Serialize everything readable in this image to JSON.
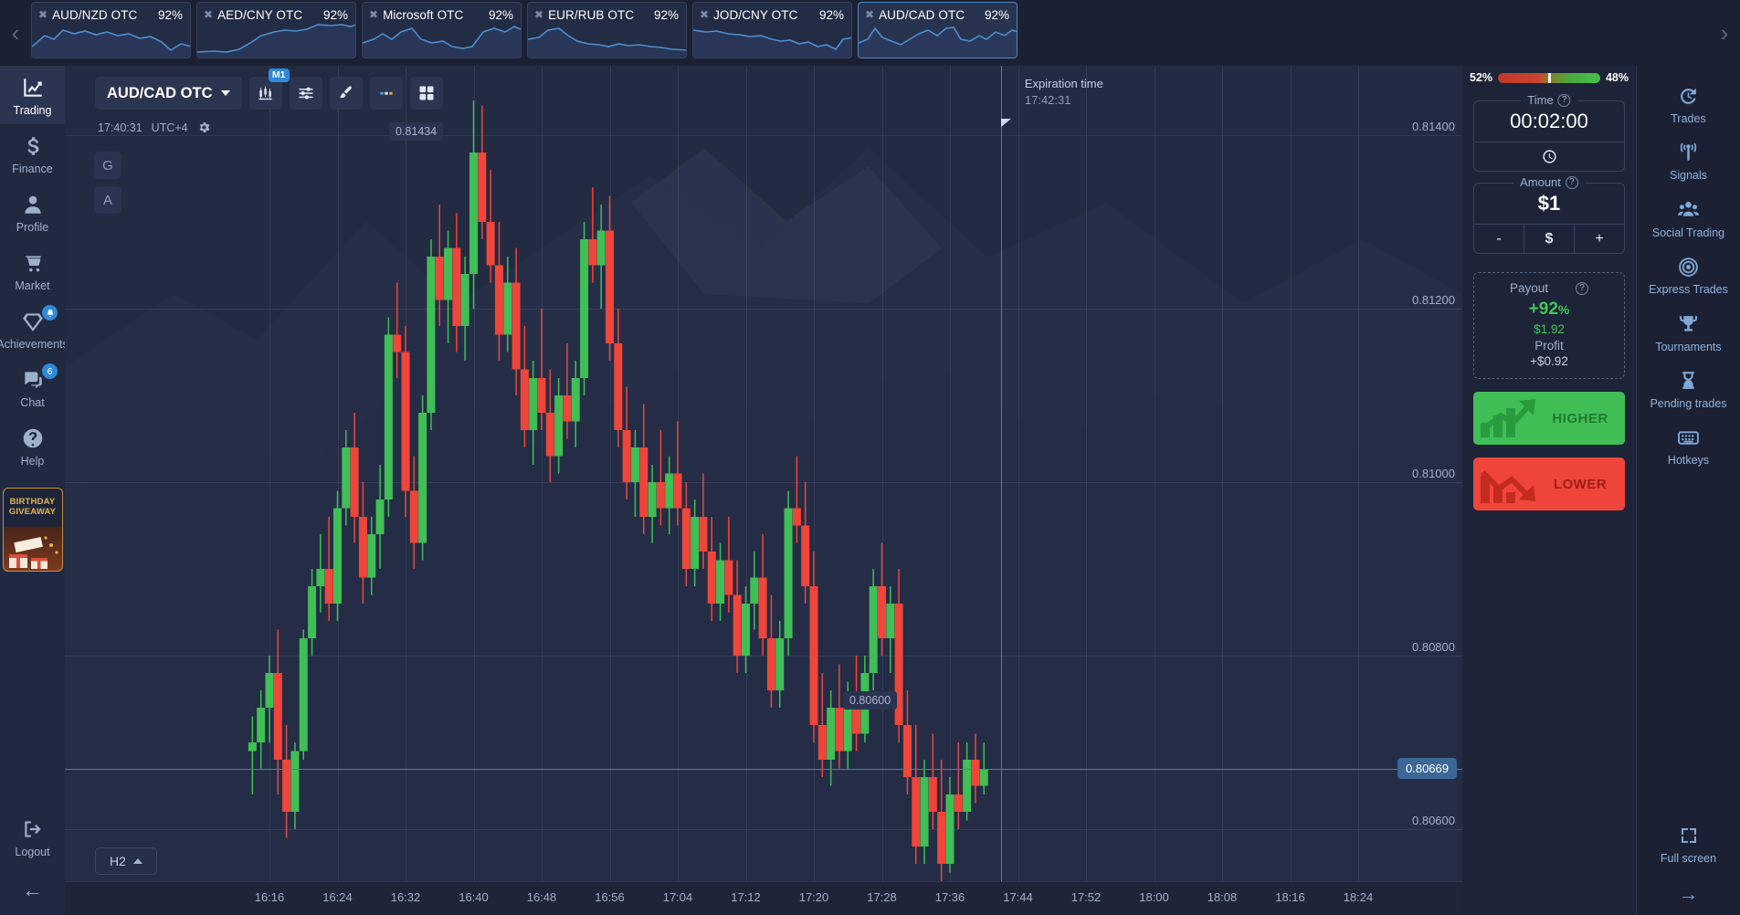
{
  "tabs": {
    "prev_arrow": "‹",
    "next_arrow": "›",
    "close_glyph": "✖",
    "items": [
      {
        "name": "AUD/NZD OTC",
        "percent": "92%",
        "active": false
      },
      {
        "name": "AED/CNY OTC",
        "percent": "92%",
        "active": false
      },
      {
        "name": "Microsoft OTC",
        "percent": "92%",
        "active": false
      },
      {
        "name": "EUR/RUB OTC",
        "percent": "92%",
        "active": false
      },
      {
        "name": "JOD/CNY OTC",
        "percent": "92%",
        "active": false
      },
      {
        "name": "AUD/CAD OTC",
        "percent": "92%",
        "active": true
      }
    ]
  },
  "sidebar_left": {
    "items": [
      {
        "label": "Trading",
        "icon": "chart-line-icon",
        "active": true,
        "badge": ""
      },
      {
        "label": "Finance",
        "icon": "dollar-icon",
        "active": false,
        "badge": ""
      },
      {
        "label": "Profile",
        "icon": "user-icon",
        "active": false,
        "badge": ""
      },
      {
        "label": "Market",
        "icon": "cart-icon",
        "active": false,
        "badge": ""
      },
      {
        "label": "Achievements",
        "icon": "diamond-icon",
        "active": false,
        "badge": "bell"
      },
      {
        "label": "Chat",
        "icon": "chat-icon",
        "active": false,
        "badge": "6"
      },
      {
        "label": "Help",
        "icon": "question-icon",
        "active": false,
        "badge": ""
      }
    ],
    "promo": {
      "line1": "BIRTHDAY",
      "line2": "GIVEAWAY"
    },
    "logout": {
      "label": "Logout",
      "icon": "logout-icon"
    },
    "collapse_arrow": "←"
  },
  "sidebar_right": {
    "items": [
      {
        "label": "Trades",
        "icon": "history-clock-icon"
      },
      {
        "label": "Signals",
        "icon": "antenna-icon"
      },
      {
        "label": "Social Trading",
        "icon": "people-group-icon"
      },
      {
        "label": "Express Trades",
        "icon": "target-icon"
      },
      {
        "label": "Tournaments",
        "icon": "trophy-icon"
      },
      {
        "label": "Pending trades",
        "icon": "hourglass-icon"
      },
      {
        "label": "Hotkeys",
        "icon": "keyboard-icon"
      }
    ],
    "fullscreen": {
      "label": "Full screen",
      "icon": "expand-icon"
    },
    "expand_arrow": "→"
  },
  "chart_toolbar": {
    "asset_label": "AUD/CAD OTC",
    "timeframe_badge": "M1",
    "buttons": [
      {
        "name": "candles-icon",
        "title": "Chart type"
      },
      {
        "name": "sliders-icon",
        "title": "Indicators"
      },
      {
        "name": "brush-icon",
        "title": "Drawing"
      },
      {
        "name": "ellipsis-icon",
        "title": "More"
      },
      {
        "name": "grid-icon",
        "title": "Layout"
      }
    ],
    "clock_time": "17:40:31",
    "timezone": "UTC+4",
    "gear_icon": "gear-icon",
    "left_markers": [
      "G",
      "A"
    ],
    "timeframe_selector": "H2"
  },
  "chart_overlay": {
    "expiration_label": "Expiration time",
    "expiration_time": "17:42:31",
    "top_price_flag": "0.81434",
    "bottom_price_flag": "0.80600",
    "current_price": "0.80669"
  },
  "trade_panel": {
    "sentiment": {
      "left_pct": "52%",
      "right_pct": "48%",
      "knob_position": 49
    },
    "time": {
      "label": "Time",
      "value": "00:02:00",
      "help": "?",
      "mode_icon": "clock-icon"
    },
    "amount": {
      "label": "Amount",
      "value": "$1",
      "help": "?",
      "minus": "-",
      "currency": "$",
      "plus": "+"
    },
    "payout": {
      "label": "Payout",
      "help": "?",
      "percent": "+92",
      "percent_sign": "%",
      "amount": "$1.92",
      "profit_label": "Profit",
      "profit_amount": "+$0.92"
    },
    "higher_button": {
      "label": "HIGHER",
      "color": "#3fbf55"
    },
    "lower_button": {
      "label": "LOWER",
      "color": "#f0453a"
    }
  },
  "chart_data": {
    "type": "candlestick",
    "title": "AUD/CAD OTC",
    "timeframe": "M1",
    "xlabel": "",
    "ylabel": "",
    "ylim": [
      0.8054,
      0.8148
    ],
    "grid": true,
    "y_ticks": [
      "0.81400",
      "0.81200",
      "0.81000",
      "0.80800",
      "0.80600"
    ],
    "y_tick_values": [
      0.814,
      0.812,
      0.81,
      0.808,
      0.806
    ],
    "x_ticks": [
      "16:16",
      "16:24",
      "16:32",
      "16:40",
      "16:48",
      "16:56",
      "17:04",
      "17:12",
      "17:20",
      "17:28",
      "17:36",
      "17:44",
      "17:52",
      "18:00",
      "18:08",
      "18:16",
      "18:24"
    ],
    "up_color": "#3fbf55",
    "down_color": "#f0453a",
    "current_price": 0.80669,
    "expiration_price_line": 0.80669,
    "candles": [
      {
        "t": "16:14",
        "o": 0.8069,
        "h": 0.8073,
        "l": 0.8064,
        "c": 0.807
      },
      {
        "t": "16:15",
        "o": 0.807,
        "h": 0.8076,
        "l": 0.8067,
        "c": 0.8074
      },
      {
        "t": "16:16",
        "o": 0.8074,
        "h": 0.808,
        "l": 0.807,
        "c": 0.8078
      },
      {
        "t": "16:17",
        "o": 0.8078,
        "h": 0.8083,
        "l": 0.8064,
        "c": 0.8068
      },
      {
        "t": "16:18",
        "o": 0.8068,
        "h": 0.8072,
        "l": 0.8059,
        "c": 0.8062
      },
      {
        "t": "16:19",
        "o": 0.8062,
        "h": 0.807,
        "l": 0.806,
        "c": 0.8069
      },
      {
        "t": "16:20",
        "o": 0.8069,
        "h": 0.8083,
        "l": 0.8068,
        "c": 0.8082
      },
      {
        "t": "16:21",
        "o": 0.8082,
        "h": 0.809,
        "l": 0.808,
        "c": 0.8088
      },
      {
        "t": "16:22",
        "o": 0.8088,
        "h": 0.8094,
        "l": 0.8085,
        "c": 0.809
      },
      {
        "t": "16:23",
        "o": 0.809,
        "h": 0.8096,
        "l": 0.8084,
        "c": 0.8086
      },
      {
        "t": "16:24",
        "o": 0.8086,
        "h": 0.8099,
        "l": 0.8084,
        "c": 0.8097
      },
      {
        "t": "16:25",
        "o": 0.8097,
        "h": 0.8106,
        "l": 0.8095,
        "c": 0.8104
      },
      {
        "t": "16:26",
        "o": 0.8104,
        "h": 0.8108,
        "l": 0.8093,
        "c": 0.8096
      },
      {
        "t": "16:27",
        "o": 0.8096,
        "h": 0.81,
        "l": 0.8086,
        "c": 0.8089
      },
      {
        "t": "16:28",
        "o": 0.8089,
        "h": 0.8096,
        "l": 0.8087,
        "c": 0.8094
      },
      {
        "t": "16:29",
        "o": 0.8094,
        "h": 0.8102,
        "l": 0.809,
        "c": 0.8098
      },
      {
        "t": "16:30",
        "o": 0.8098,
        "h": 0.8119,
        "l": 0.8096,
        "c": 0.8117
      },
      {
        "t": "16:31",
        "o": 0.8117,
        "h": 0.8123,
        "l": 0.8112,
        "c": 0.8115
      },
      {
        "t": "16:32",
        "o": 0.8115,
        "h": 0.8118,
        "l": 0.8096,
        "c": 0.8099
      },
      {
        "t": "16:33",
        "o": 0.8099,
        "h": 0.8103,
        "l": 0.809,
        "c": 0.8093
      },
      {
        "t": "16:34",
        "o": 0.8093,
        "h": 0.811,
        "l": 0.8091,
        "c": 0.8108
      },
      {
        "t": "16:35",
        "o": 0.8108,
        "h": 0.8128,
        "l": 0.8106,
        "c": 0.8126
      },
      {
        "t": "16:36",
        "o": 0.8126,
        "h": 0.8132,
        "l": 0.8118,
        "c": 0.8121
      },
      {
        "t": "16:37",
        "o": 0.8121,
        "h": 0.8129,
        "l": 0.8116,
        "c": 0.8127
      },
      {
        "t": "16:38",
        "o": 0.8127,
        "h": 0.8131,
        "l": 0.8115,
        "c": 0.8118
      },
      {
        "t": "16:39",
        "o": 0.8118,
        "h": 0.8126,
        "l": 0.8114,
        "c": 0.8124
      },
      {
        "t": "16:40",
        "o": 0.8124,
        "h": 0.8144,
        "l": 0.812,
        "c": 0.8138
      },
      {
        "t": "16:41",
        "o": 0.8138,
        "h": 0.81434,
        "l": 0.8128,
        "c": 0.813
      },
      {
        "t": "16:42",
        "o": 0.813,
        "h": 0.8136,
        "l": 0.8123,
        "c": 0.8125
      },
      {
        "t": "16:43",
        "o": 0.8125,
        "h": 0.813,
        "l": 0.8114,
        "c": 0.8117
      },
      {
        "t": "16:44",
        "o": 0.8117,
        "h": 0.8126,
        "l": 0.8115,
        "c": 0.8123
      },
      {
        "t": "16:45",
        "o": 0.8123,
        "h": 0.8127,
        "l": 0.811,
        "c": 0.8113
      },
      {
        "t": "16:46",
        "o": 0.8113,
        "h": 0.8118,
        "l": 0.8104,
        "c": 0.8106
      },
      {
        "t": "16:47",
        "o": 0.8106,
        "h": 0.8114,
        "l": 0.8102,
        "c": 0.8112
      },
      {
        "t": "16:48",
        "o": 0.8112,
        "h": 0.812,
        "l": 0.8106,
        "c": 0.8108
      },
      {
        "t": "16:49",
        "o": 0.8108,
        "h": 0.8113,
        "l": 0.81,
        "c": 0.8103
      },
      {
        "t": "16:50",
        "o": 0.8103,
        "h": 0.8112,
        "l": 0.8101,
        "c": 0.811
      },
      {
        "t": "16:51",
        "o": 0.811,
        "h": 0.8116,
        "l": 0.8105,
        "c": 0.8107
      },
      {
        "t": "16:52",
        "o": 0.8107,
        "h": 0.8114,
        "l": 0.8104,
        "c": 0.8112
      },
      {
        "t": "16:53",
        "o": 0.8112,
        "h": 0.813,
        "l": 0.811,
        "c": 0.8128
      },
      {
        "t": "16:54",
        "o": 0.8128,
        "h": 0.8134,
        "l": 0.8123,
        "c": 0.8125
      },
      {
        "t": "16:55",
        "o": 0.8125,
        "h": 0.8132,
        "l": 0.812,
        "c": 0.8129
      },
      {
        "t": "16:56",
        "o": 0.8129,
        "h": 0.8133,
        "l": 0.8114,
        "c": 0.8116
      },
      {
        "t": "16:57",
        "o": 0.8116,
        "h": 0.812,
        "l": 0.8104,
        "c": 0.8106
      },
      {
        "t": "16:58",
        "o": 0.8106,
        "h": 0.8111,
        "l": 0.8098,
        "c": 0.81
      },
      {
        "t": "16:59",
        "o": 0.81,
        "h": 0.8106,
        "l": 0.8096,
        "c": 0.8104
      },
      {
        "t": "17:00",
        "o": 0.8104,
        "h": 0.8109,
        "l": 0.8094,
        "c": 0.8096
      },
      {
        "t": "17:01",
        "o": 0.8096,
        "h": 0.8102,
        "l": 0.8093,
        "c": 0.81
      },
      {
        "t": "17:02",
        "o": 0.81,
        "h": 0.8106,
        "l": 0.8095,
        "c": 0.8097
      },
      {
        "t": "17:03",
        "o": 0.8097,
        "h": 0.8103,
        "l": 0.8094,
        "c": 0.8101
      },
      {
        "t": "17:04",
        "o": 0.8101,
        "h": 0.8107,
        "l": 0.8095,
        "c": 0.8097
      },
      {
        "t": "17:05",
        "o": 0.8097,
        "h": 0.81,
        "l": 0.8088,
        "c": 0.809
      },
      {
        "t": "17:06",
        "o": 0.809,
        "h": 0.8098,
        "l": 0.8088,
        "c": 0.8096
      },
      {
        "t": "17:07",
        "o": 0.8096,
        "h": 0.8101,
        "l": 0.809,
        "c": 0.8092
      },
      {
        "t": "17:08",
        "o": 0.8092,
        "h": 0.8096,
        "l": 0.8084,
        "c": 0.8086
      },
      {
        "t": "17:09",
        "o": 0.8086,
        "h": 0.8093,
        "l": 0.8084,
        "c": 0.8091
      },
      {
        "t": "17:10",
        "o": 0.8091,
        "h": 0.8096,
        "l": 0.8085,
        "c": 0.8087
      },
      {
        "t": "17:11",
        "o": 0.8087,
        "h": 0.8091,
        "l": 0.8078,
        "c": 0.808
      },
      {
        "t": "17:12",
        "o": 0.808,
        "h": 0.8088,
        "l": 0.8078,
        "c": 0.8086
      },
      {
        "t": "17:13",
        "o": 0.8086,
        "h": 0.8092,
        "l": 0.8083,
        "c": 0.8089
      },
      {
        "t": "17:14",
        "o": 0.8089,
        "h": 0.8094,
        "l": 0.808,
        "c": 0.8082
      },
      {
        "t": "17:15",
        "o": 0.8082,
        "h": 0.8087,
        "l": 0.8074,
        "c": 0.8076
      },
      {
        "t": "17:16",
        "o": 0.8076,
        "h": 0.8084,
        "l": 0.8074,
        "c": 0.8082
      },
      {
        "t": "17:17",
        "o": 0.8082,
        "h": 0.8099,
        "l": 0.808,
        "c": 0.8097
      },
      {
        "t": "17:18",
        "o": 0.8097,
        "h": 0.8103,
        "l": 0.8093,
        "c": 0.8095
      },
      {
        "t": "17:19",
        "o": 0.8095,
        "h": 0.81,
        "l": 0.8086,
        "c": 0.8088
      },
      {
        "t": "17:20",
        "o": 0.8088,
        "h": 0.8092,
        "l": 0.807,
        "c": 0.8072
      },
      {
        "t": "17:21",
        "o": 0.8072,
        "h": 0.8078,
        "l": 0.8066,
        "c": 0.8068
      },
      {
        "t": "17:22",
        "o": 0.8068,
        "h": 0.8076,
        "l": 0.8065,
        "c": 0.8074
      },
      {
        "t": "17:23",
        "o": 0.8074,
        "h": 0.8079,
        "l": 0.8067,
        "c": 0.8069
      },
      {
        "t": "17:24",
        "o": 0.8069,
        "h": 0.8077,
        "l": 0.8067,
        "c": 0.8075
      },
      {
        "t": "17:25",
        "o": 0.8075,
        "h": 0.808,
        "l": 0.8069,
        "c": 0.8071
      },
      {
        "t": "17:26",
        "o": 0.8071,
        "h": 0.808,
        "l": 0.807,
        "c": 0.8078
      },
      {
        "t": "17:27",
        "o": 0.8078,
        "h": 0.809,
        "l": 0.8076,
        "c": 0.8088
      },
      {
        "t": "17:28",
        "o": 0.8088,
        "h": 0.8093,
        "l": 0.808,
        "c": 0.8082
      },
      {
        "t": "17:29",
        "o": 0.8082,
        "h": 0.8088,
        "l": 0.8078,
        "c": 0.8086
      },
      {
        "t": "17:30",
        "o": 0.8086,
        "h": 0.809,
        "l": 0.807,
        "c": 0.8072
      },
      {
        "t": "17:31",
        "o": 0.8072,
        "h": 0.8076,
        "l": 0.8064,
        "c": 0.8066
      },
      {
        "t": "17:32",
        "o": 0.8066,
        "h": 0.8072,
        "l": 0.8056,
        "c": 0.8058
      },
      {
        "t": "17:33",
        "o": 0.8058,
        "h": 0.8068,
        "l": 0.8056,
        "c": 0.8066
      },
      {
        "t": "17:34",
        "o": 0.8066,
        "h": 0.8071,
        "l": 0.806,
        "c": 0.8062
      },
      {
        "t": "17:35",
        "o": 0.8062,
        "h": 0.8068,
        "l": 0.8054,
        "c": 0.8056
      },
      {
        "t": "17:36",
        "o": 0.8056,
        "h": 0.8066,
        "l": 0.8055,
        "c": 0.8064
      },
      {
        "t": "17:37",
        "o": 0.8064,
        "h": 0.807,
        "l": 0.806,
        "c": 0.8062
      },
      {
        "t": "17:38",
        "o": 0.8062,
        "h": 0.807,
        "l": 0.8061,
        "c": 0.8068
      },
      {
        "t": "17:39",
        "o": 0.8068,
        "h": 0.8071,
        "l": 0.8063,
        "c": 0.8065
      },
      {
        "t": "17:40",
        "o": 0.8065,
        "h": 0.807,
        "l": 0.8064,
        "c": 0.80669
      }
    ]
  }
}
